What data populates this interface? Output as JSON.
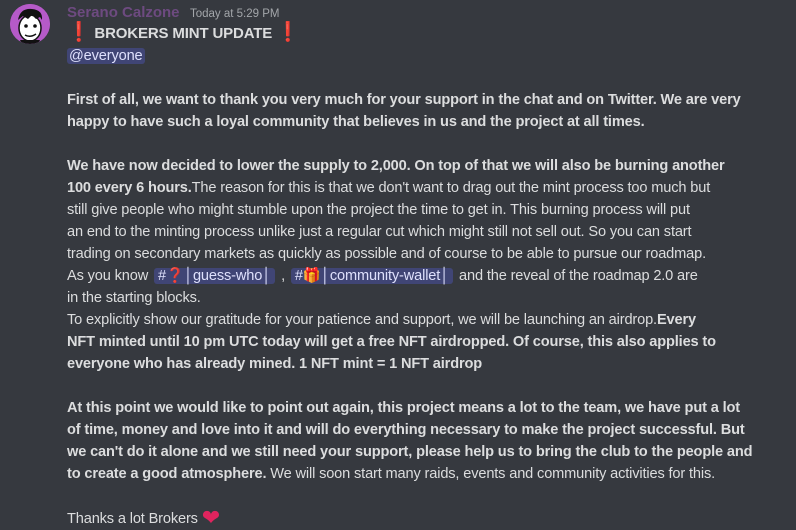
{
  "author": {
    "name": "Serano Calzone",
    "timestamp": "Today at 5:29 PM"
  },
  "icons": {
    "avatar": "cartoon-avatar",
    "exclamation": "red-exclamation-mark",
    "heart": "red-heart",
    "question": "red-question-mark",
    "gift": "gift-box"
  },
  "colors": {
    "background": "#36393f",
    "username": "#9b59b6",
    "mention_bg": "#3c4270",
    "text": "#dcddde"
  },
  "message": {
    "title": "BROKERS MINT UPDATE",
    "mention": "@everyone",
    "p1_l1": "First of all, we want to thank you very much for your support in the chat and on Twitter. We are very",
    "p1_l2": "happy to have such a loyal community that believes in us and the project at all times.",
    "p2_l1": "We have now decided to lower the supply to 2,000. On top of that we will also be burning another",
    "p2_l2_bold": "100 every 6 hours.",
    "p2_l2_rest": "The reason for this is that we don't want to drag out the mint process too much but",
    "p2_l3": "still give people who might stumble upon the project the time to get in.  This burning process will put",
    "p2_l4": "an end to the minting process unlike just a regular cut which might still not sell out. So you can start",
    "p2_l5": "trading on secondary markets as quickly as possible and of course to be able to pursue our roadmap.",
    "p2_l6_a": "As you know",
    "channel1": "#❓│guess-who│",
    "p2_l6_sep": ",",
    "channel2": "#🎁│community-wallet│",
    "p2_l6_b": "and the reveal of the roadmap 2.0 are",
    "p2_l7": "in the starting blocks.",
    "p2_l8_a": "To explicitly show our gratitude for your patience and support, we will be launching an airdrop.",
    "p2_l8_b": "Every",
    "p2_l9": "NFT minted until 10 pm UTC today will get a free NFT airdropped. Of course, this also applies to",
    "p2_l10": "everyone who has already mined. 1 NFT mint = 1 NFT airdrop",
    "p3_l1": "At this point we would like to point out again, this project means a lot to the team, we have put a lot",
    "p3_l2": "of time, money and love into it and will do everything necessary to make the project successful. But",
    "p3_l3": "we can't do it alone and we still need your support, please help us to bring the club to the people and",
    "p3_l4_bold": "to create a good atmosphere.",
    "p3_l4_rest": " We will soon start many raids, events and community activities for this.",
    "sign": "Thanks a lot Brokers"
  }
}
